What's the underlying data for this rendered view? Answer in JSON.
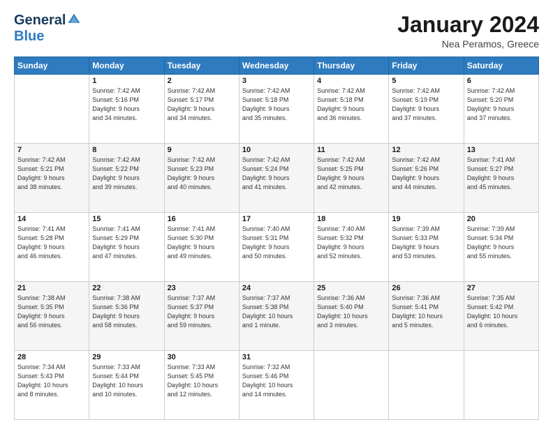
{
  "header": {
    "logo_general": "General",
    "logo_blue": "Blue",
    "month_title": "January 2024",
    "location": "Nea Peramos, Greece"
  },
  "days_of_week": [
    "Sunday",
    "Monday",
    "Tuesday",
    "Wednesday",
    "Thursday",
    "Friday",
    "Saturday"
  ],
  "weeks": [
    [
      {
        "num": "",
        "info": ""
      },
      {
        "num": "1",
        "info": "Sunrise: 7:42 AM\nSunset: 5:16 PM\nDaylight: 9 hours\nand 34 minutes."
      },
      {
        "num": "2",
        "info": "Sunrise: 7:42 AM\nSunset: 5:17 PM\nDaylight: 9 hours\nand 34 minutes."
      },
      {
        "num": "3",
        "info": "Sunrise: 7:42 AM\nSunset: 5:18 PM\nDaylight: 9 hours\nand 35 minutes."
      },
      {
        "num": "4",
        "info": "Sunrise: 7:42 AM\nSunset: 5:18 PM\nDaylight: 9 hours\nand 36 minutes."
      },
      {
        "num": "5",
        "info": "Sunrise: 7:42 AM\nSunset: 5:19 PM\nDaylight: 9 hours\nand 37 minutes."
      },
      {
        "num": "6",
        "info": "Sunrise: 7:42 AM\nSunset: 5:20 PM\nDaylight: 9 hours\nand 37 minutes."
      }
    ],
    [
      {
        "num": "7",
        "info": "Sunrise: 7:42 AM\nSunset: 5:21 PM\nDaylight: 9 hours\nand 38 minutes."
      },
      {
        "num": "8",
        "info": "Sunrise: 7:42 AM\nSunset: 5:22 PM\nDaylight: 9 hours\nand 39 minutes."
      },
      {
        "num": "9",
        "info": "Sunrise: 7:42 AM\nSunset: 5:23 PM\nDaylight: 9 hours\nand 40 minutes."
      },
      {
        "num": "10",
        "info": "Sunrise: 7:42 AM\nSunset: 5:24 PM\nDaylight: 9 hours\nand 41 minutes."
      },
      {
        "num": "11",
        "info": "Sunrise: 7:42 AM\nSunset: 5:25 PM\nDaylight: 9 hours\nand 42 minutes."
      },
      {
        "num": "12",
        "info": "Sunrise: 7:42 AM\nSunset: 5:26 PM\nDaylight: 9 hours\nand 44 minutes."
      },
      {
        "num": "13",
        "info": "Sunrise: 7:41 AM\nSunset: 5:27 PM\nDaylight: 9 hours\nand 45 minutes."
      }
    ],
    [
      {
        "num": "14",
        "info": "Sunrise: 7:41 AM\nSunset: 5:28 PM\nDaylight: 9 hours\nand 46 minutes."
      },
      {
        "num": "15",
        "info": "Sunrise: 7:41 AM\nSunset: 5:29 PM\nDaylight: 9 hours\nand 47 minutes."
      },
      {
        "num": "16",
        "info": "Sunrise: 7:41 AM\nSunset: 5:30 PM\nDaylight: 9 hours\nand 49 minutes."
      },
      {
        "num": "17",
        "info": "Sunrise: 7:40 AM\nSunset: 5:31 PM\nDaylight: 9 hours\nand 50 minutes."
      },
      {
        "num": "18",
        "info": "Sunrise: 7:40 AM\nSunset: 5:32 PM\nDaylight: 9 hours\nand 52 minutes."
      },
      {
        "num": "19",
        "info": "Sunrise: 7:39 AM\nSunset: 5:33 PM\nDaylight: 9 hours\nand 53 minutes."
      },
      {
        "num": "20",
        "info": "Sunrise: 7:39 AM\nSunset: 5:34 PM\nDaylight: 9 hours\nand 55 minutes."
      }
    ],
    [
      {
        "num": "21",
        "info": "Sunrise: 7:38 AM\nSunset: 5:35 PM\nDaylight: 9 hours\nand 56 minutes."
      },
      {
        "num": "22",
        "info": "Sunrise: 7:38 AM\nSunset: 5:36 PM\nDaylight: 9 hours\nand 58 minutes."
      },
      {
        "num": "23",
        "info": "Sunrise: 7:37 AM\nSunset: 5:37 PM\nDaylight: 9 hours\nand 59 minutes."
      },
      {
        "num": "24",
        "info": "Sunrise: 7:37 AM\nSunset: 5:38 PM\nDaylight: 10 hours\nand 1 minute."
      },
      {
        "num": "25",
        "info": "Sunrise: 7:36 AM\nSunset: 5:40 PM\nDaylight: 10 hours\nand 3 minutes."
      },
      {
        "num": "26",
        "info": "Sunrise: 7:36 AM\nSunset: 5:41 PM\nDaylight: 10 hours\nand 5 minutes."
      },
      {
        "num": "27",
        "info": "Sunrise: 7:35 AM\nSunset: 5:42 PM\nDaylight: 10 hours\nand 6 minutes."
      }
    ],
    [
      {
        "num": "28",
        "info": "Sunrise: 7:34 AM\nSunset: 5:43 PM\nDaylight: 10 hours\nand 8 minutes."
      },
      {
        "num": "29",
        "info": "Sunrise: 7:33 AM\nSunset: 5:44 PM\nDaylight: 10 hours\nand 10 minutes."
      },
      {
        "num": "30",
        "info": "Sunrise: 7:33 AM\nSunset: 5:45 PM\nDaylight: 10 hours\nand 12 minutes."
      },
      {
        "num": "31",
        "info": "Sunrise: 7:32 AM\nSunset: 5:46 PM\nDaylight: 10 hours\nand 14 minutes."
      },
      {
        "num": "",
        "info": ""
      },
      {
        "num": "",
        "info": ""
      },
      {
        "num": "",
        "info": ""
      }
    ]
  ]
}
